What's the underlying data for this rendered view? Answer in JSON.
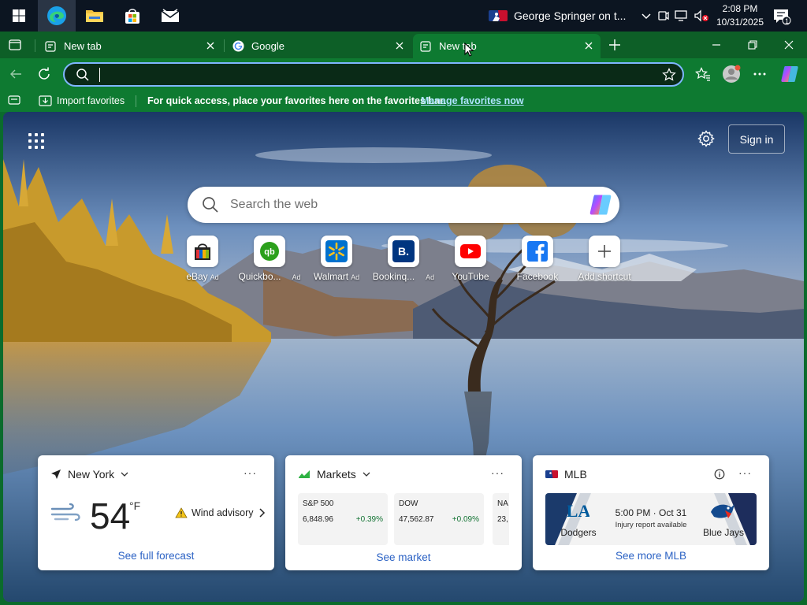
{
  "taskbar": {
    "news_text": "George Springer on t...",
    "time": "2:08 PM",
    "date": "10/31/2025",
    "notification_count": "1"
  },
  "tabs": [
    {
      "title": "New tab",
      "active": false
    },
    {
      "title": "Google",
      "active": false
    },
    {
      "title": "New tab",
      "active": true
    }
  ],
  "address_bar": {
    "value": "",
    "placeholder": ""
  },
  "favorites_bar": {
    "import_label": "Import favorites",
    "prompt": "For quick access, place your favorites here on the favorites bar.",
    "manage_link": "Manage favorites now"
  },
  "page": {
    "signin_label": "Sign in",
    "search_placeholder": "Search the web"
  },
  "shortcuts": [
    {
      "label": "eBay",
      "ad": "Ad",
      "icon": "ebay-icon"
    },
    {
      "label": "Quickbo...",
      "ad": "Ad",
      "icon": "quickbooks-icon"
    },
    {
      "label": "Walmart",
      "ad": "Ad",
      "icon": "walmart-icon"
    },
    {
      "label": "Bookinq...",
      "ad": "Ad",
      "icon": "booking-icon"
    },
    {
      "label": "YouTube",
      "ad": "",
      "icon": "youtube-icon"
    },
    {
      "label": "Facebook",
      "ad": "",
      "icon": "facebook-icon"
    },
    {
      "label": "Add shortcut",
      "ad": "",
      "icon": "plus-icon"
    }
  ],
  "weather": {
    "location": "New York",
    "temperature": "54",
    "unit": "°F",
    "advisory": "Wind advisory",
    "footer": "See full forecast"
  },
  "markets": {
    "title": "Markets",
    "footer": "See market",
    "items": [
      {
        "name": "S&P 500",
        "value": "6,848.96",
        "change": "+0.39%"
      },
      {
        "name": "DOW",
        "value": "47,562.87",
        "change": "+0.09%"
      },
      {
        "name": "NA",
        "value": "23,",
        "change": ""
      }
    ]
  },
  "mlb": {
    "title": "MLB",
    "home_team": "Dodgers",
    "away_team": "Blue Jays",
    "game_time": "5:00 PM · Oct 31",
    "game_info": "Injury report available",
    "footer": "See more MLB"
  },
  "colors": {
    "browser_frame": "#0e7a31",
    "tab_strip": "#0d5f27",
    "link": "#2b62c4",
    "positive": "#137333"
  }
}
